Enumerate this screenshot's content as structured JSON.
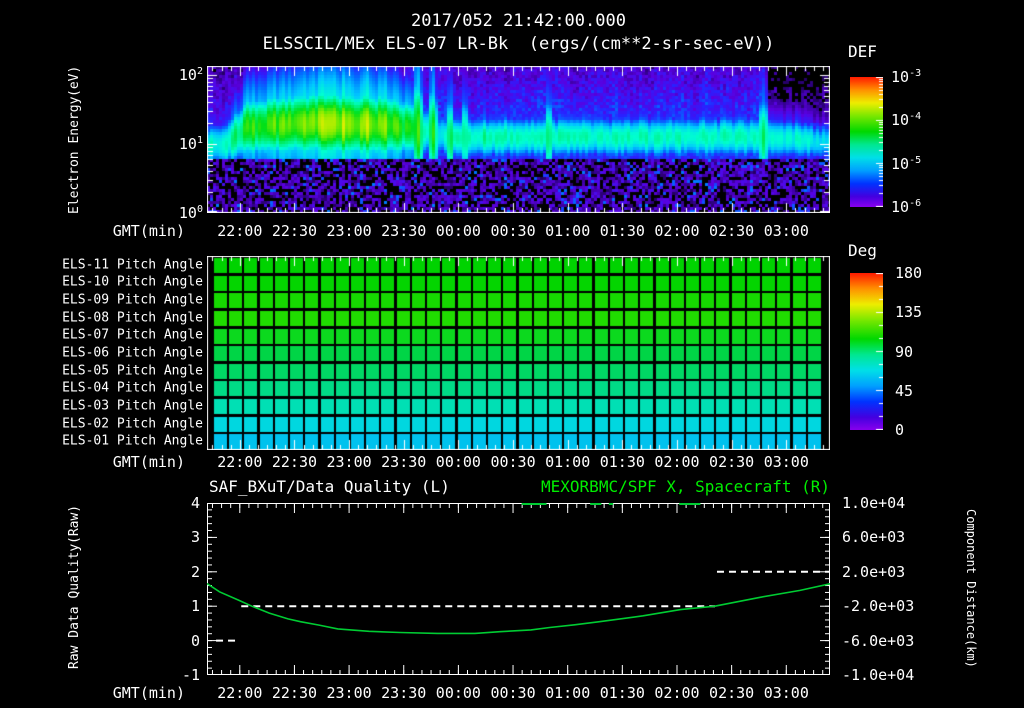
{
  "colors": {
    "background": "#000000",
    "text": "#ffffff",
    "accent_green": "#00ee00",
    "curve_green": "#00cc33"
  },
  "title": {
    "line1": "2017/052 21:42:00.000",
    "line2": "ELSSCIL/MEx ELS-07 LR-Bk  (ergs/(cm**2-sr-sec-eV))"
  },
  "axis": {
    "gmt_label": "GMT(min)",
    "time_start": "21:42",
    "time_end": "03:24",
    "time_span_min": 342,
    "time_major_labels": [
      "22:00",
      "22:30",
      "23:00",
      "23:30",
      "00:00",
      "00:30",
      "01:00",
      "01:30",
      "02:00",
      "02:30",
      "03:00"
    ],
    "time_major_start_frac": 0.05263,
    "time_major_step_frac": 0.08772,
    "time_minor_step_frac": 0.01462
  },
  "spectrogram": {
    "ylabel_line1": "Electron Energy",
    "ylabel_line2": "(eV)",
    "yticks": [
      "10^0",
      "10^1",
      "10^2"
    ],
    "colorbar_title": "DEF",
    "colorbar_ticks": [
      "10^-3",
      "10^-4",
      "10^-5",
      "10^-6"
    ]
  },
  "pitch": {
    "colorbar_title": "Deg",
    "colorbar_ticks": [
      "180",
      "135",
      "90",
      "45",
      "0"
    ]
  },
  "lineplot": {
    "legend_left": "SAF_BXuT/Data Quality (L)",
    "legend_right": "MEXORBMC/SPF X, Spacecraft (R)",
    "left_label_line1": "Raw Data Quality",
    "left_label_line2": "(Raw)",
    "left_ticks": [
      "4",
      "3",
      "2",
      "1",
      "0",
      "-1"
    ],
    "right_label_line1": "Component Distance",
    "right_label_line2": "(km)",
    "right_ticks": [
      "1.0e+04",
      "6.0e+03",
      "2.0e+03",
      "-2.0e+03",
      "-6.0e+03",
      "-1.0e+04"
    ]
  },
  "colorbar_gradient_top_to_bottom": [
    [
      0,
      "#ff1a00"
    ],
    [
      0.1,
      "#ff9100"
    ],
    [
      0.2,
      "#eeee00"
    ],
    [
      0.3,
      "#7ae800"
    ],
    [
      0.42,
      "#00d800"
    ],
    [
      0.52,
      "#00e890"
    ],
    [
      0.62,
      "#00e0e8"
    ],
    [
      0.72,
      "#00a0ff"
    ],
    [
      0.82,
      "#0033ff"
    ],
    [
      0.92,
      "#4400e0"
    ],
    [
      1,
      "#8800ee"
    ]
  ],
  "chart_data": [
    {
      "type": "heatmap",
      "name": "electron_energy_spectrogram",
      "title": "ELSSCIL/MEx ELS-07 LR-Bk",
      "units": "ergs/(cm**2-sr-sec-eV)",
      "x_range_gmt": [
        "21:42",
        "03:24"
      ],
      "x_span_min": 342,
      "y_log10_ev_range": [
        0,
        2.13
      ],
      "flux_log10_range": [
        -6.5,
        -3
      ],
      "colormap_stops": [
        [
          -6.6,
          "#000000"
        ],
        [
          -6.3,
          "#38009a"
        ],
        [
          -6.0,
          "#5a00e0"
        ],
        [
          -5.7,
          "#2a20ff"
        ],
        [
          -5.35,
          "#0070ff"
        ],
        [
          -5.0,
          "#00c8ff"
        ],
        [
          -4.65,
          "#00ffd0"
        ],
        [
          -4.35,
          "#00f078"
        ],
        [
          -4.1,
          "#00e018"
        ],
        [
          -3.8,
          "#86ec00"
        ],
        [
          -3.5,
          "#eeee00"
        ],
        [
          -3.2,
          "#ff9100"
        ],
        [
          -3.0,
          "#ff2a00"
        ]
      ],
      "band": {
        "t_min": [
          0,
          10,
          23,
          58,
          98,
          118,
          133,
          308,
          342
        ],
        "peak_log10_flux": [
          -4.65,
          -4.6,
          -4.05,
          -3.8,
          -3.85,
          -4.35,
          -4.55,
          -4.6,
          -4.85
        ],
        "center_log10_ev": [
          0.97,
          1.0,
          1.26,
          1.3,
          1.28,
          1.2,
          1.1,
          1.1,
          1.02
        ],
        "width_log10": [
          0.2,
          0.22,
          0.28,
          0.3,
          0.3,
          0.24,
          0.2,
          0.2,
          0.18
        ]
      },
      "streaks": [
        {
          "t": 62,
          "boost": 0.25
        },
        {
          "t": 75,
          "boost": 0.3
        },
        {
          "t": 88,
          "boost": 0.25
        },
        {
          "t": 116,
          "boost": 0.4,
          "tall": true
        },
        {
          "t": 120,
          "boost": -0.5
        },
        {
          "t": 124,
          "boost": 0.45,
          "tall": true
        },
        {
          "t": 128,
          "boost": -0.45
        },
        {
          "t": 133,
          "boost": 0.35,
          "tall": true
        },
        {
          "t": 141,
          "boost": 0.3,
          "tall": true
        },
        {
          "t": 152,
          "boost": 0.25
        },
        {
          "t": 188,
          "boost": 0.3,
          "tall": true
        },
        {
          "t": 208,
          "boost": 0.25
        },
        {
          "t": 246,
          "boost": 0.2
        },
        {
          "t": 305,
          "boost": 0.3,
          "tall": true
        }
      ],
      "noise_seed": 20170521
    },
    {
      "type": "heatmap",
      "name": "pitch_angle_grid",
      "value_range_deg": [
        0,
        180
      ],
      "n_time_cells": 40,
      "rows": [
        {
          "label": "ELS-11 Pitch Angle",
          "deg": 102,
          "color": "#00d300"
        },
        {
          "label": "ELS-10 Pitch Angle",
          "deg": 103,
          "color": "#04d500"
        },
        {
          "label": "ELS-09 Pitch Angle",
          "deg": 106,
          "color": "#16d900"
        },
        {
          "label": "ELS-08 Pitch Angle",
          "deg": 108,
          "color": "#20dc00"
        },
        {
          "label": "ELS-07 Pitch Angle",
          "deg": 101,
          "color": "#0cd91e"
        },
        {
          "label": "ELS-06 Pitch Angle",
          "deg": 96,
          "color": "#00d546"
        },
        {
          "label": "ELS-05 Pitch Angle",
          "deg": 92,
          "color": "#00d764"
        },
        {
          "label": "ELS-04 Pitch Angle",
          "deg": 87,
          "color": "#00db86"
        },
        {
          "label": "ELS-03 Pitch Angle",
          "deg": 80,
          "color": "#00e0b4"
        },
        {
          "label": "ELS-02 Pitch Angle",
          "deg": 72,
          "color": "#00d7e0"
        },
        {
          "label": "ELS-01 Pitch Angle",
          "deg": 66,
          "color": "#00c2ee"
        }
      ]
    },
    {
      "type": "line",
      "name": "quality_and_spacecraft_position",
      "left_axis": {
        "label": "Raw Data Quality (Raw)",
        "range": [
          -1,
          4
        ],
        "major_step": 1,
        "minor_step": 0.2
      },
      "right_axis": {
        "label": "Component Distance (km)",
        "range": [
          -10000,
          10000
        ],
        "major_step": 4000
      },
      "series": [
        {
          "name": "SAF_BXuT/Data Quality (L)",
          "axis": "left",
          "color": "#ffffff",
          "style": "dashed",
          "segments": [
            {
              "value": 0,
              "x_frac": [
                0.0145,
                0.0498
              ]
            },
            {
              "value": 1,
              "x_frac": [
                0.055,
                0.8154
              ]
            },
            {
              "value": 2,
              "x_frac": [
                0.8186,
                1.0
              ]
            }
          ]
        },
        {
          "name": "MEXORBMC/SPF X, Spacecraft (R)",
          "axis": "right",
          "color": "#00cc33",
          "style": "solid",
          "points_frac_km": [
            [
              0.0,
              640
            ],
            [
              0.02,
              -320
            ],
            [
              0.05,
              -1280
            ],
            [
              0.072,
              -2000
            ],
            [
              0.1,
              -2800
            ],
            [
              0.13,
              -3480
            ],
            [
              0.15,
              -3800
            ],
            [
              0.18,
              -4200
            ],
            [
              0.21,
              -4640
            ],
            [
              0.26,
              -4920
            ],
            [
              0.31,
              -5060
            ],
            [
              0.37,
              -5160
            ],
            [
              0.43,
              -5160
            ],
            [
              0.47,
              -4960
            ],
            [
              0.52,
              -4760
            ],
            [
              0.55,
              -4480
            ],
            [
              0.59,
              -4160
            ],
            [
              0.63,
              -3800
            ],
            [
              0.7,
              -3120
            ],
            [
              0.76,
              -2400
            ],
            [
              0.815,
              -2000
            ],
            [
              0.888,
              -960
            ],
            [
              0.952,
              -160
            ],
            [
              1.0,
              600
            ]
          ]
        }
      ],
      "event_marks_x_frac": [
        [
          0.505,
          0.545
        ],
        [
          0.615,
          0.633
        ],
        [
          0.645,
          0.652
        ],
        [
          0.758,
          0.792
        ]
      ]
    }
  ]
}
